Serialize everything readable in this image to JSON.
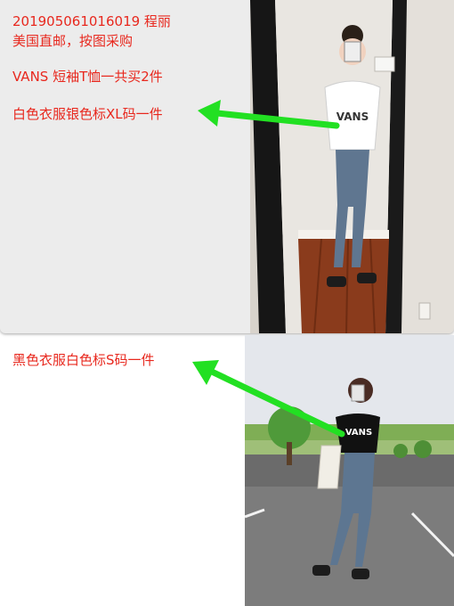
{
  "note": {
    "line1": "201905061016019    程丽",
    "line2": "美国直邮，按图采购",
    "line3": "VANS  短袖T恤一共买2件",
    "line4": "白色衣服银色标XL码一件"
  },
  "second_note": "黑色衣服白色标S码一件",
  "photo_top": {
    "shirt_text": "VANS",
    "shirt_color": "#ffffff"
  },
  "photo_bottom": {
    "shirt_text": "VANS",
    "shirt_color": "#111111"
  },
  "colors": {
    "text": "#e8281e",
    "arrow": "#22e022",
    "card": "#ececec"
  }
}
